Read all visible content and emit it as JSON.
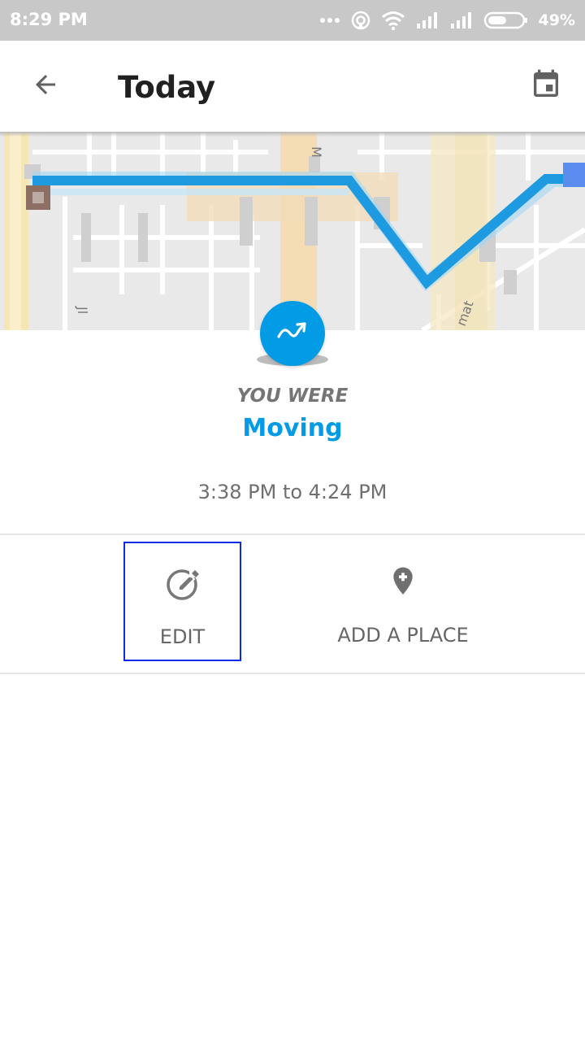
{
  "status_bar": {
    "time": "8:29 PM",
    "battery_percent": "49%"
  },
  "app_bar": {
    "title": "Today",
    "back_icon": "arrow-back-icon",
    "calendar_icon": "calendar-icon"
  },
  "map": {
    "route_color": "#1e9be0",
    "street_labels": [
      "M",
      "Jl",
      "mat"
    ]
  },
  "activity": {
    "icon": "trending-up-icon",
    "label": "YOU WERE",
    "name": "Moving",
    "time_range": "3:38 PM to 4:24 PM",
    "accent_color": "#039be5"
  },
  "actions": {
    "edit_label": "EDIT",
    "add_place_label": "ADD A PLACE"
  }
}
